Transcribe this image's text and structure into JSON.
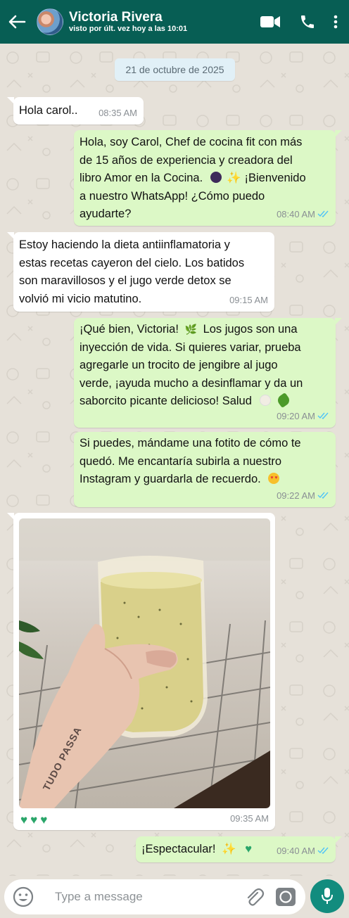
{
  "header": {
    "contact_name": "Victoria Rivera",
    "status": "visto por últ. vez hoy a las 10:01",
    "icons": [
      "back-arrow-icon",
      "video-call-icon",
      "phone-icon",
      "more-options-icon"
    ]
  },
  "chat": {
    "date_chip": "21 de octubre de 2025",
    "messages": [
      {
        "direction": "in",
        "text": "Hola carol..",
        "time": "08:35 AM"
      },
      {
        "direction": "out",
        "text_lines": [
          "Hola, soy Carol, Chef de cocina fit con más",
          "de 15 años de experiencia y creadora del",
          "libro Amor en la Cocina.",
          "¡Bienvenido",
          "a nuestro WhatsApp! ¿Cómo puedo",
          "ayudarte?"
        ],
        "time": "08:40 AM",
        "read": true
      },
      {
        "direction": "in",
        "text_lines": [
          "Estoy haciendo la dieta antiinflamatoria y",
          "estas recetas cayeron del cielo. Los batidos",
          "son maravillosos y el jugo verde detox se",
          "volvió mi vicio matutino."
        ],
        "time": "09:15 AM"
      },
      {
        "direction": "out",
        "text_lines": [
          "¡Qué bien, Victoria!",
          "Los jugos son una",
          "inyección de vida. Si quieres variar, prueba",
          "agregarle un trocito de jengibre al jugo",
          "verde, ¡ayuda mucho a desinflamar y da un",
          "saborcito picante delicioso! Salud"
        ],
        "time": "09:20 AM",
        "read": true
      },
      {
        "direction": "out",
        "text_lines": [
          "Si puedes, mándame una fotito de cómo te",
          "quedó. Me encantaría subirla a nuestro",
          "Instagram y guardarla de recuerdo."
        ],
        "time": "09:22 AM",
        "read": true
      },
      {
        "direction": "in",
        "type": "image",
        "photo_text": "TUDO PASSA",
        "time": "09:35 AM"
      },
      {
        "direction": "out",
        "text": "¡Espectacular!",
        "time": "09:40 AM",
        "read": true
      }
    ]
  },
  "input": {
    "placeholder": "Type a message"
  },
  "colors": {
    "header": "#075e54",
    "outgoing_bubble": "#dcf8c6",
    "incoming_bubble": "#ffffff",
    "read_ticks": "#4fc3f7",
    "mic_button": "#128c7e",
    "date_chip": "#e1f0f7"
  }
}
